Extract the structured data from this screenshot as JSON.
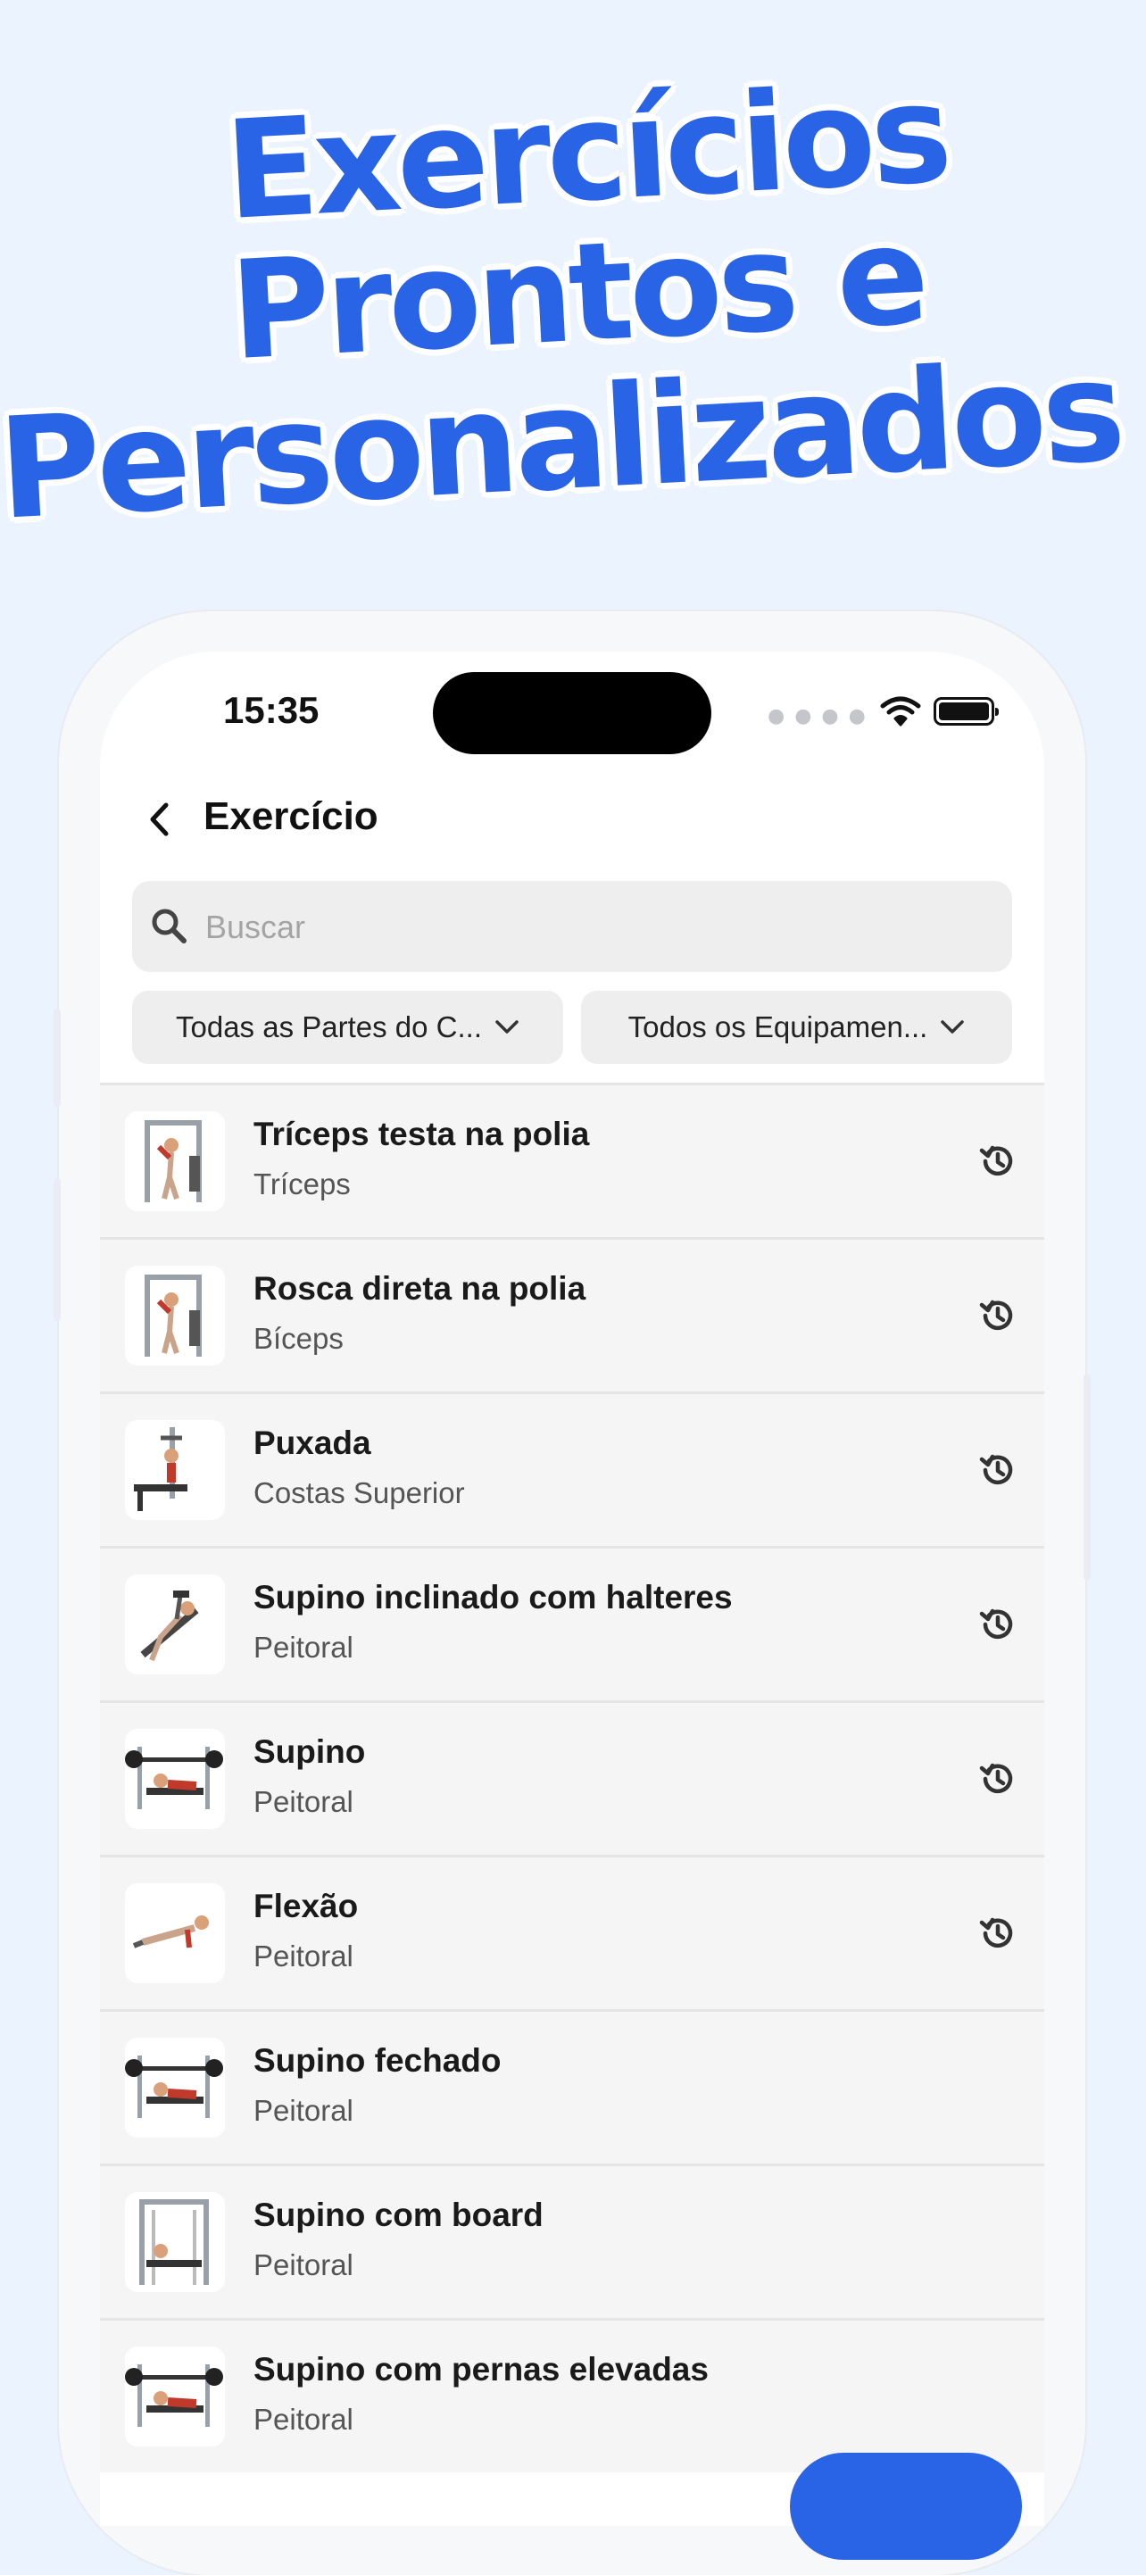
{
  "headline": {
    "line1": "Exercícios",
    "line2": "Prontos e",
    "line3": "Personalizados"
  },
  "status_bar": {
    "time": "15:35"
  },
  "nav": {
    "title": "Exercício"
  },
  "search": {
    "placeholder": "Buscar"
  },
  "filters": {
    "body_parts": "Todas as Partes do C...",
    "equipment": "Todos os Equipamen..."
  },
  "exercises": [
    {
      "name": "Tríceps testa na polia",
      "category": "Tríceps",
      "history": true,
      "icon": "cable-machine-icon"
    },
    {
      "name": "Rosca direta na polia",
      "category": "Bíceps",
      "history": true,
      "icon": "cable-machine-icon"
    },
    {
      "name": "Puxada",
      "category": "Costas Superior",
      "history": true,
      "icon": "lat-pulldown-icon"
    },
    {
      "name": "Supino inclinado com halteres",
      "category": "Peitoral",
      "history": true,
      "icon": "incline-bench-icon"
    },
    {
      "name": "Supino",
      "category": "Peitoral",
      "history": true,
      "icon": "bench-press-icon"
    },
    {
      "name": "Flexão",
      "category": "Peitoral",
      "history": true,
      "icon": "push-up-icon"
    },
    {
      "name": "Supino fechado",
      "category": "Peitoral",
      "history": false,
      "icon": "bench-press-icon"
    },
    {
      "name": "Supino com board",
      "category": "Peitoral",
      "history": false,
      "icon": "power-rack-icon"
    },
    {
      "name": "Supino com pernas elevadas",
      "category": "Peitoral",
      "history": false,
      "icon": "bench-press-icon"
    }
  ],
  "colors": {
    "accent": "#2a64e6",
    "background": "#ebf3fe"
  }
}
